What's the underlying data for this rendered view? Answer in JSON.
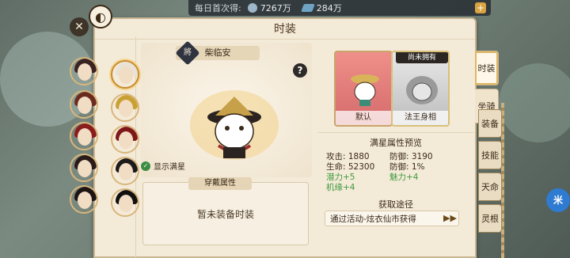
{
  "currency": {
    "daily_first_label": "每日首次得:",
    "coins": "7267万",
    "gems": "284万"
  },
  "panel": {
    "title": "时装"
  },
  "character": {
    "name": "柴临安"
  },
  "preview": {
    "show_full_star": "显示满星"
  },
  "worn": {
    "title": "穿戴属性",
    "empty_text": "暂未装备时装"
  },
  "outfits": [
    {
      "label": "默认",
      "tag": ""
    },
    {
      "label": "法王身相",
      "tag": "尚未拥有"
    }
  ],
  "stats": {
    "title": "满星属性预览",
    "rows": [
      {
        "a": "攻击:  1880",
        "b": "防御:  3190"
      },
      {
        "a": "生命:  52300",
        "b": "防御:  1%"
      },
      {
        "a": "潜力+5",
        "b": "魅力+4"
      },
      {
        "a": "机缘+4",
        "b": ""
      }
    ]
  },
  "source": {
    "title": "获取途径",
    "text": "通过活动-炫衣仙市获得"
  },
  "tabs": [
    {
      "label": "时装"
    },
    {
      "label": "坐骑"
    }
  ],
  "side_tabs": [
    {
      "label": "装备"
    },
    {
      "label": "技能"
    },
    {
      "label": "天命"
    },
    {
      "label": "灵根"
    }
  ],
  "assist_label": "米",
  "colors": {
    "panel_bg": "#f4ead8",
    "accent_gold": "#e1b560",
    "default_card": "#e07a78",
    "green_stat": "#3e9a3e"
  }
}
